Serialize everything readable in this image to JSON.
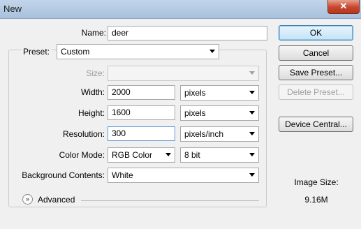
{
  "window": {
    "title": "New",
    "close_glyph": "✕"
  },
  "form": {
    "name": {
      "label": "Name:",
      "value": "deer"
    },
    "preset": {
      "label": "Preset:",
      "value": "Custom"
    },
    "size": {
      "label": "Size:",
      "value": ""
    },
    "width": {
      "label": "Width:",
      "value": "2000",
      "unit": "pixels"
    },
    "height": {
      "label": "Height:",
      "value": "1600",
      "unit": "pixels"
    },
    "resolution": {
      "label": "Resolution:",
      "value": "300",
      "unit": "pixels/inch"
    },
    "color_mode": {
      "label": "Color Mode:",
      "value": "RGB Color",
      "depth": "8 bit"
    },
    "background": {
      "label": "Background Contents:",
      "value": "White"
    },
    "advanced": {
      "label": "Advanced",
      "icon_glyph": "»"
    }
  },
  "buttons": {
    "ok": "OK",
    "cancel": "Cancel",
    "save_preset": "Save Preset...",
    "delete_preset": "Delete Preset...",
    "device_central": "Device Central..."
  },
  "image_size": {
    "label": "Image Size:",
    "value": "9.16M"
  }
}
